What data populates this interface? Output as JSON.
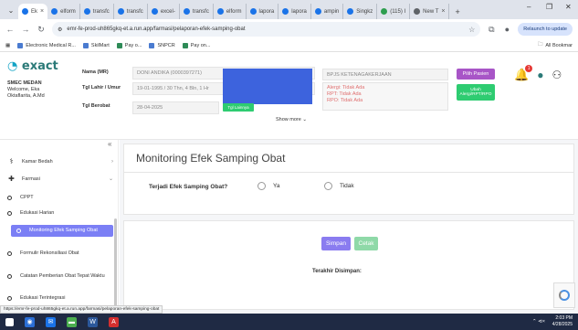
{
  "browser": {
    "tabs": [
      {
        "label": "Ek",
        "active": true
      },
      {
        "label": "elform",
        "active": false
      },
      {
        "label": "transfc",
        "active": false
      },
      {
        "label": "transfc",
        "active": false
      },
      {
        "label": "excel-",
        "active": false
      },
      {
        "label": "transfc",
        "active": false
      },
      {
        "label": "elform",
        "active": false
      },
      {
        "label": "lapora",
        "active": false
      },
      {
        "label": "lapora",
        "active": false
      },
      {
        "label": "ampin",
        "active": false
      },
      {
        "label": "Singkz",
        "active": false
      },
      {
        "label": "(115) I",
        "active": false
      },
      {
        "label": "New T",
        "active": false
      }
    ],
    "url": "emr-fe-prod-uh865gkq-et.a.run.app/farmasi/pelaporan-efek-samping-obat",
    "refresh_label": "Relaunch to update",
    "bookmarks": [
      "Electronic Medical R...",
      "SkilMart",
      "Pay o...",
      "SNPCR",
      "Pay on..."
    ],
    "bookmarks_all": "All Bookmar"
  },
  "header": {
    "logo_text": "exact",
    "clinic_name": "SMEC MEDAN",
    "welcome_line1": "Welcome, Eka",
    "welcome_line2": "Oktaflarita, A.Md",
    "labels": {
      "nama": "Nama (MR)",
      "tgl_lahir": "Tgl Lahir / Umur",
      "tgl_berobat": "Tgl Berobat"
    },
    "values": {
      "nama": "DONI ANDIKA (0000397271)",
      "tgl_lahir": "19-01-1995 / 30 Thn, 4 Bln, 1 Hr",
      "tgl_berobat": "28-04-2025",
      "bpjs": "BPJS KETENAGAKERJAAN"
    },
    "allergies": [
      "Alergi: Tidak Ada",
      "RPT: Tidak Ada",
      "RPO: Tidak Ada"
    ],
    "tgl_button": "Tgl Lainnya",
    "show_more": "Show more",
    "pilih_pasien": "Pilih Pasien",
    "ubah_alergi": "Ubah Alergi/RPT/RPO",
    "notif_count": "1",
    "accent_color": "#2b7a78"
  },
  "sidebar": {
    "collapse_icon": "«",
    "items": [
      {
        "label": "Kamar Bedah",
        "icon": "surgery-icon"
      },
      {
        "label": "Farmasi",
        "icon": "pharmacy-icon"
      }
    ],
    "subitems": [
      {
        "label": "CPPT"
      },
      {
        "label": "Edukasi Harian"
      },
      {
        "label": "Monitoring Efek Samping Obat",
        "active": true
      },
      {
        "label": "Formulir Rekonsiliasi Obat"
      },
      {
        "label": "Catatan Pemberian Obat Tepat Waktu"
      },
      {
        "label": "Edukasi Terintegrasi"
      }
    ]
  },
  "main": {
    "title": "Monitoring Efek Samping Obat",
    "question": "Terjadi Efek Samping Obat?",
    "options": [
      "Ya",
      "Tidak"
    ],
    "save_label": "Simpan",
    "print_label": "Cetak",
    "last_saved_label": "Terakhir Disimpan:"
  },
  "status_url": "https://emr-fe-prod-uh865gkq-et.a.run.app/farmasi/pelaporan-efek-samping-obat",
  "taskbar": {
    "time": "2:03 PM",
    "date": "4/28/2025",
    "tray": "⌃ ⊲×"
  }
}
